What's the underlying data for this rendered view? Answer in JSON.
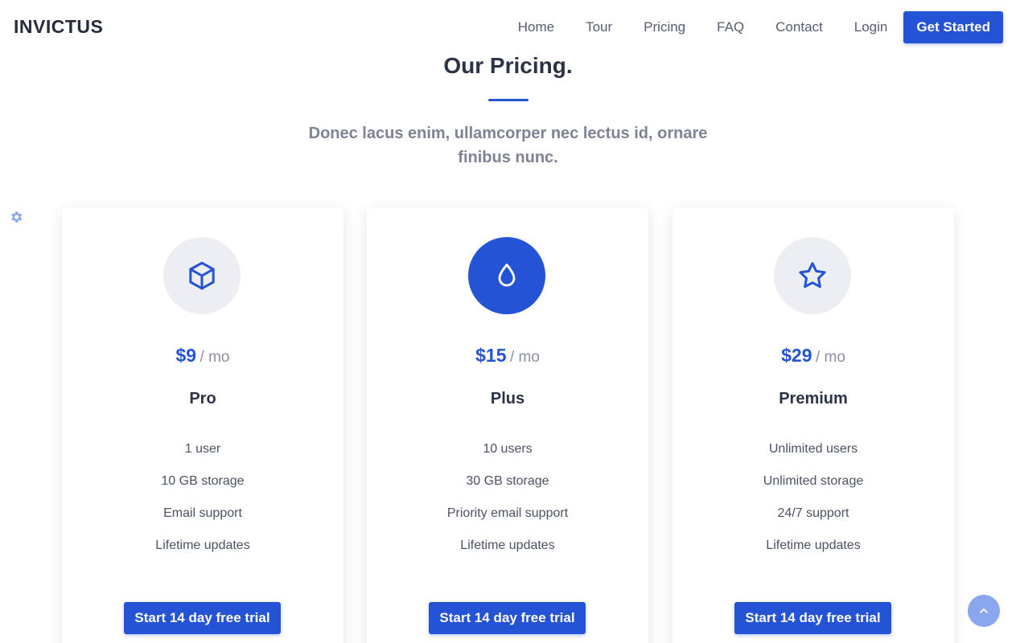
{
  "brand": "INVICTUS",
  "nav": {
    "links": [
      "Home",
      "Tour",
      "Pricing",
      "FAQ",
      "Contact",
      "Login"
    ],
    "cta": "Get Started"
  },
  "section": {
    "title": "Our Pricing.",
    "subtitle": "Donec lacus enim, ullamcorper nec lectus id, ornare finibus nunc."
  },
  "plans": [
    {
      "icon": "cube-icon",
      "price": "$9",
      "per": "/ mo",
      "name": "Pro",
      "features": [
        "1 user",
        "10 GB storage",
        "Email support",
        "Lifetime updates"
      ],
      "button": "Start 14 day free trial"
    },
    {
      "icon": "droplet-icon",
      "price": "$15",
      "per": "/ mo",
      "name": "Plus",
      "features": [
        "10 users",
        "30 GB storage",
        "Priority email support",
        "Lifetime updates"
      ],
      "button": "Start 14 day free trial"
    },
    {
      "icon": "star-icon",
      "price": "$29",
      "per": "/ mo",
      "name": "Premium",
      "features": [
        "Unlimited users",
        "Unlimited storage",
        "24/7 support",
        "Lifetime updates"
      ],
      "button": "Start 14 day free trial"
    }
  ],
  "colors": {
    "accent": "#2453d6",
    "text": "#2c3345",
    "muted": "#7d8393",
    "icon_bg": "#eceef1",
    "scroll_btn": "#8aa6ee"
  }
}
